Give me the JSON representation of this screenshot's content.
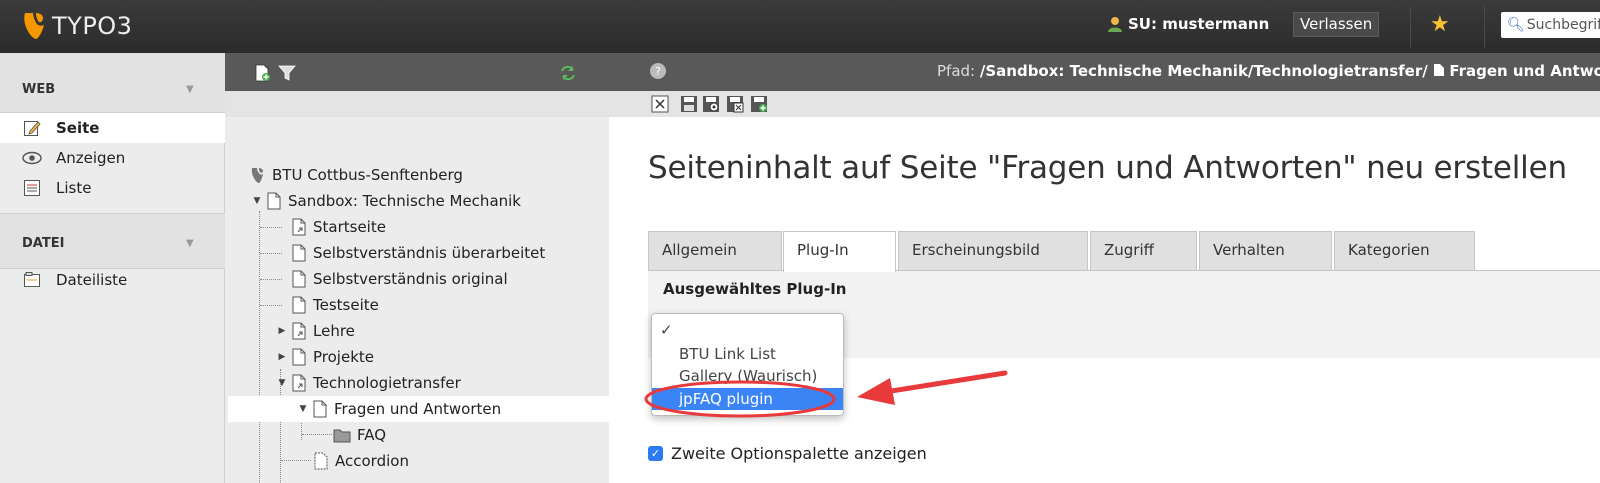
{
  "topbar": {
    "logo_text": "TYPO3",
    "user_label": "SU: mustermann",
    "leave_label": "Verlassen",
    "search_placeholder": "Suchbegriff"
  },
  "modules": {
    "web_header": "WEB",
    "web_items": [
      {
        "label": "Seite",
        "icon": "page-edit-icon"
      },
      {
        "label": "Anzeigen",
        "icon": "eye-icon"
      },
      {
        "label": "Liste",
        "icon": "list-icon"
      }
    ],
    "file_header": "DATEI",
    "file_items": [
      {
        "label": "Dateiliste",
        "icon": "filelist-icon"
      }
    ]
  },
  "tree": {
    "root": "BTU Cottbus-Senftenberg",
    "nodes": [
      "Sandbox: Technische Mechanik",
      "Startseite",
      "Selbstverständnis überarbeitet",
      "Selbstverständnis original",
      "Testseite",
      "Lehre",
      "Projekte",
      "Technologietransfer",
      "Fragen und Antworten",
      "FAQ",
      "Accordion"
    ]
  },
  "docheader": {
    "path_label": "Pfad:",
    "path_value": "/Sandbox: Technische Mechanik/Technologietransfer/",
    "page_name": "Fragen und Antworten"
  },
  "content": {
    "title": "Seiteninhalt auf Seite \"Fragen und Antworten\" neu erstellen",
    "tabs": [
      "Allgemein",
      "Plug-In",
      "Erscheinungsbild",
      "Zugriff",
      "Verhalten",
      "Kategorien"
    ],
    "active_tab": "Plug-In",
    "panel_label": "Ausgewähltes Plug-In",
    "plugin_options": [
      "",
      "BTU Link List",
      "Gallery (Waurisch)",
      "jpFAQ plugin"
    ],
    "checkmark": "✓",
    "highlighted_option": "jpFAQ plugin",
    "checkbox_label": "Zweite Optionspalette anzeigen",
    "checkbox_checked": true
  },
  "colors": {
    "topbar": "#2f2f2f",
    "accent_orange": "#f49700",
    "highlight_blue": "#3a84f5",
    "annotation_red": "#e8393b"
  }
}
